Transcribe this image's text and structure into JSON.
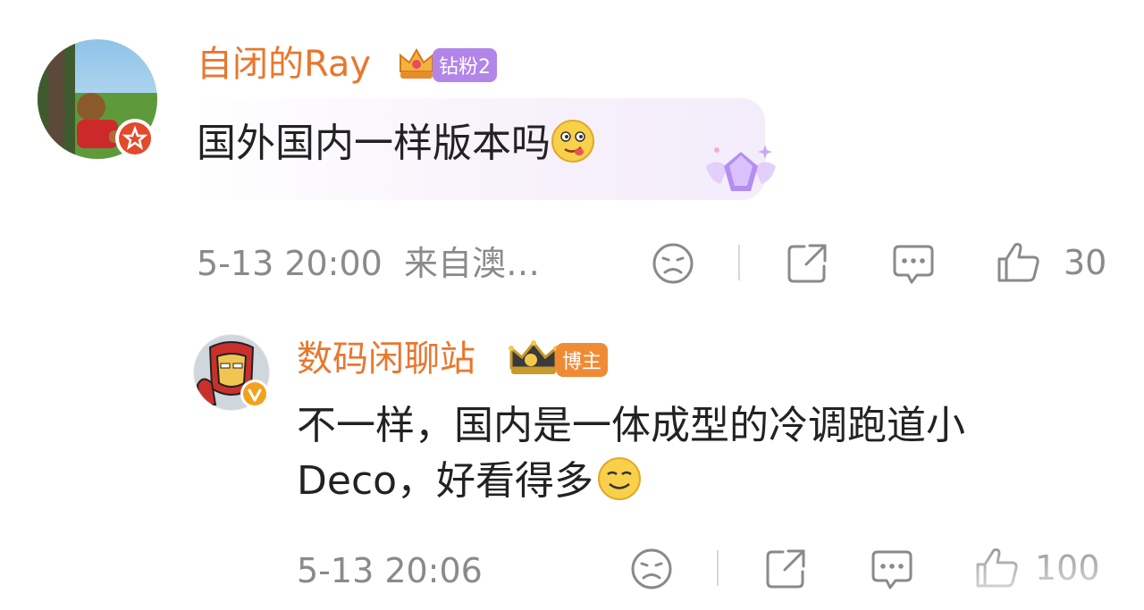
{
  "comments": [
    {
      "username": "自闭的Ray",
      "badge_label": "钻粉2",
      "text": "国外国内一样版本吗",
      "time_location": "5-13 20:00  来自澳…",
      "like_count": "30"
    },
    {
      "username": "数码闲聊站",
      "badge_label": "博主",
      "text_line1": "不一样，国内是一体成型的冷调跑道小",
      "text_line2": "Deco，好看得多",
      "time": "5-13 20:06",
      "like_count": "100"
    }
  ],
  "colors": {
    "username": "#e8772e",
    "text": "#222222",
    "meta": "#8a8a8a",
    "badge_purple": "#b285e8",
    "badge_orange": "#f08b35"
  },
  "icons": [
    "dislike-icon",
    "share-icon",
    "comment-icon",
    "like-icon",
    "crown-icon",
    "verified-icon",
    "diamond-icon",
    "smiley-icon"
  ]
}
